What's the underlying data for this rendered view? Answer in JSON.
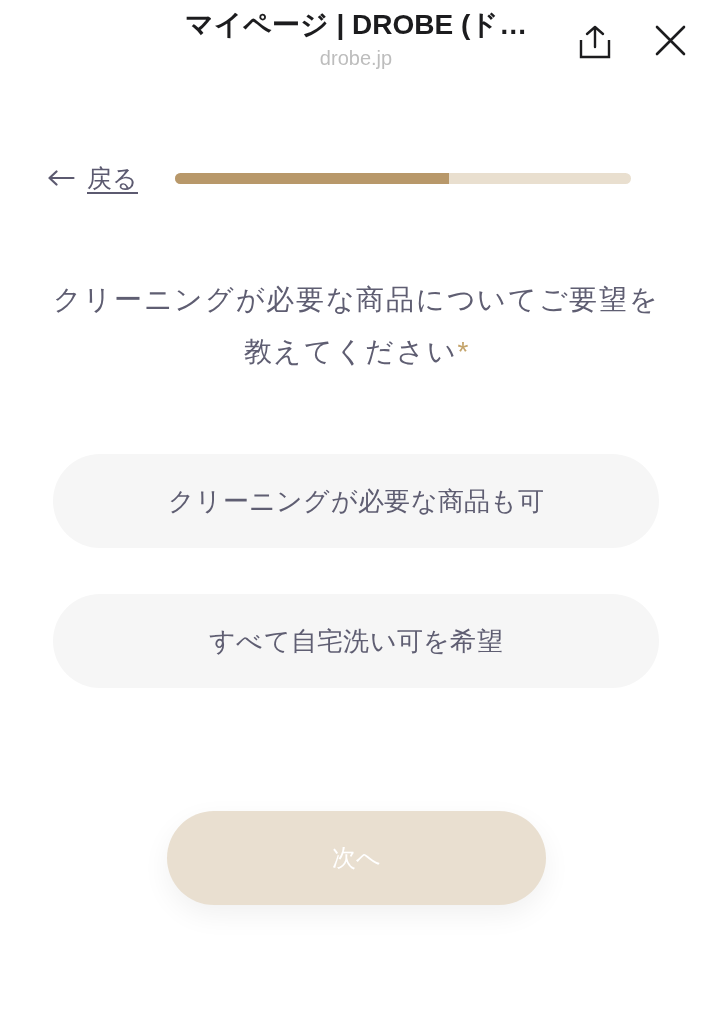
{
  "header": {
    "title": "マイページ | DROBE (ド…",
    "subtitle": "drobe.jp"
  },
  "back_link": {
    "label": "戻る"
  },
  "progress": {
    "level": 0.6
  },
  "question": {
    "text": "クリーニングが必要な商品についてご要望を教えてください",
    "required_mark": "*"
  },
  "options": [
    {
      "label": "クリーニングが必要な商品も可",
      "selected": false
    },
    {
      "label": "すべて自宅洗い可を希望",
      "selected": false
    }
  ],
  "next_button": {
    "label": "次へ",
    "disabled": true
  }
}
